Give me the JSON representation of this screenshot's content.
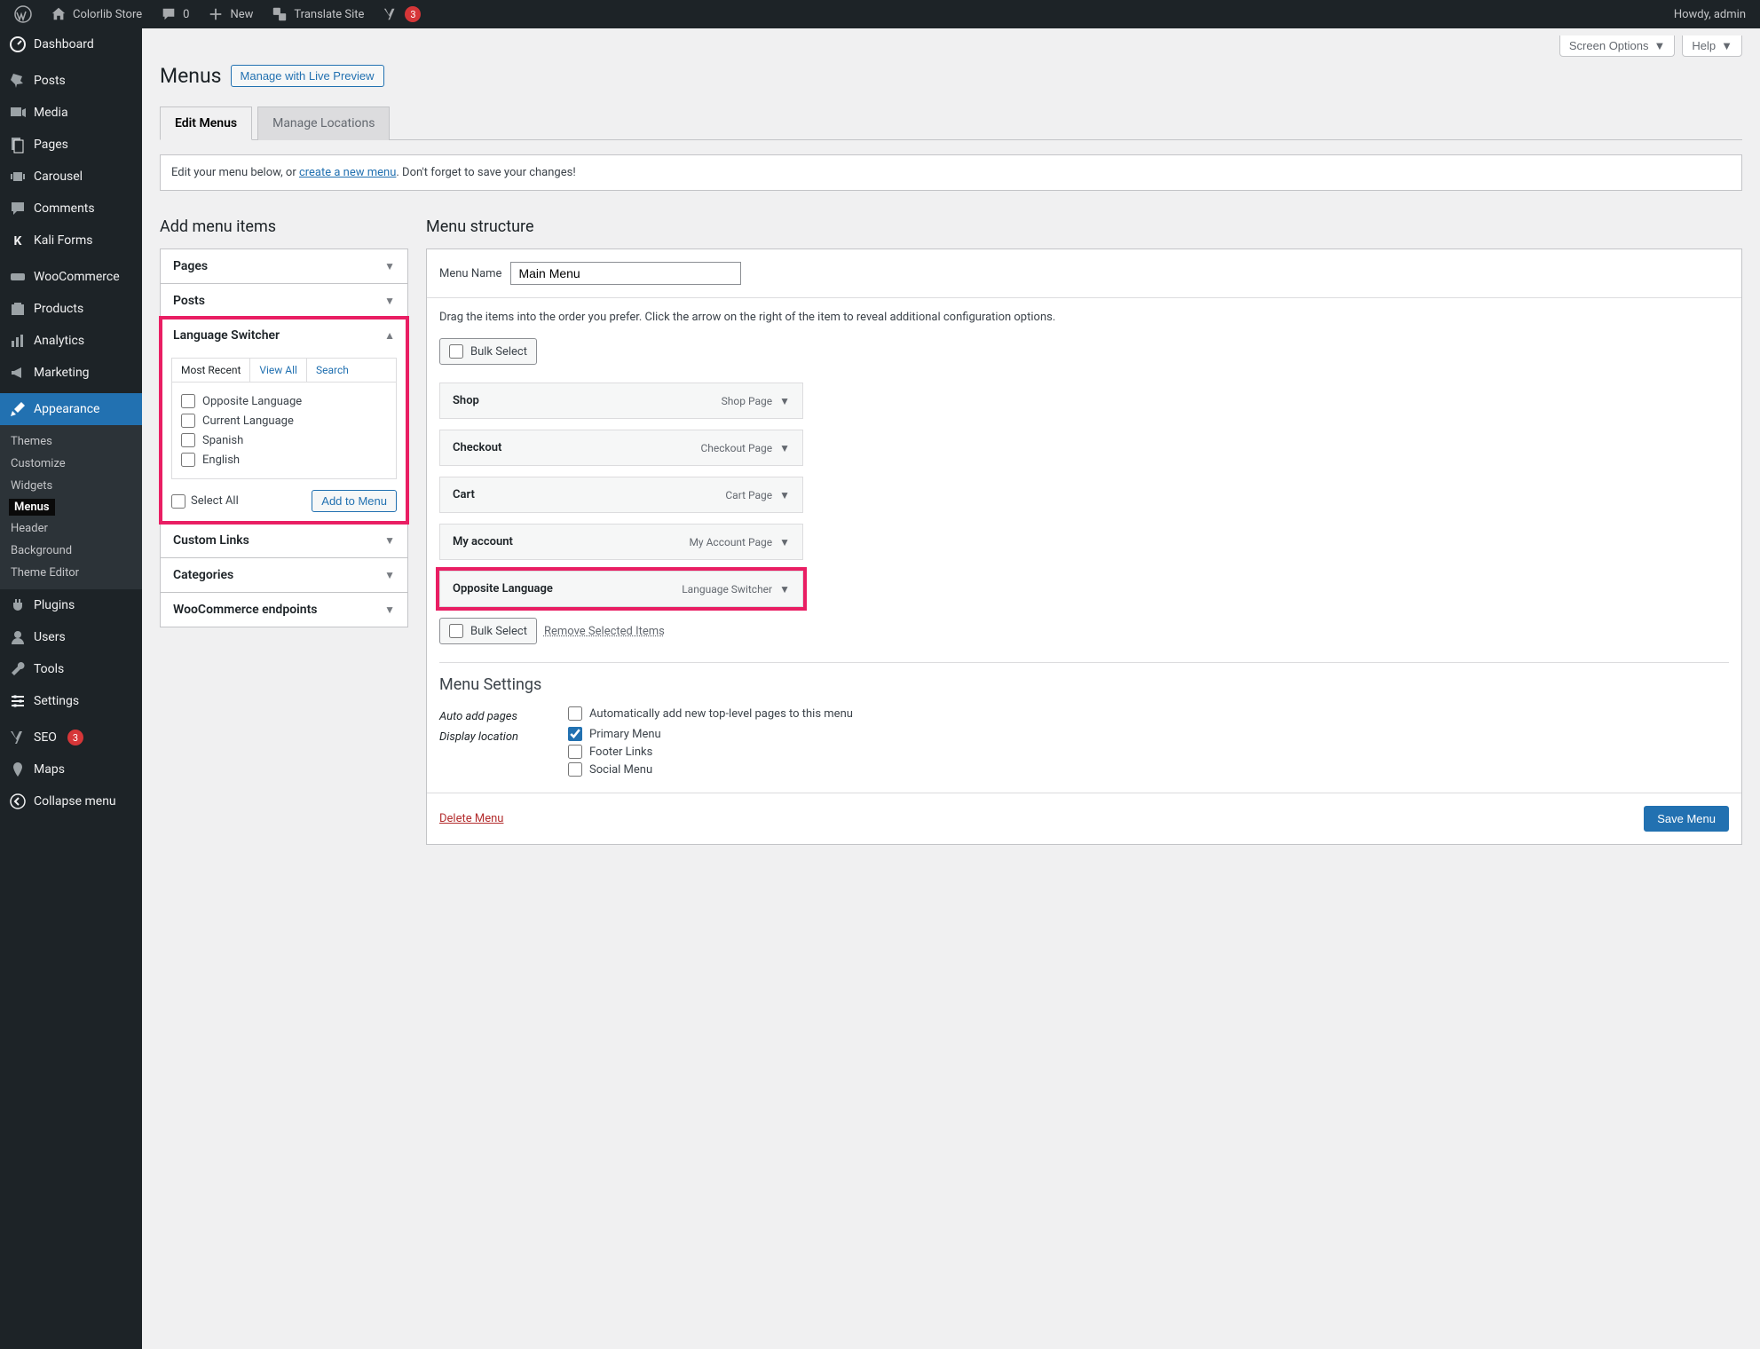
{
  "adminbar": {
    "site_name": "Colorlib Store",
    "comments_count": "0",
    "new_label": "New",
    "translate_label": "Translate Site",
    "yoast_count": "3",
    "howdy": "Howdy, admin"
  },
  "sidebar": {
    "items": [
      {
        "label": "Dashboard"
      },
      {
        "label": "Posts"
      },
      {
        "label": "Media"
      },
      {
        "label": "Pages"
      },
      {
        "label": "Carousel"
      },
      {
        "label": "Comments"
      },
      {
        "label": "Kali Forms"
      },
      {
        "label": "WooCommerce"
      },
      {
        "label": "Products"
      },
      {
        "label": "Analytics"
      },
      {
        "label": "Marketing"
      },
      {
        "label": "Appearance"
      },
      {
        "label": "Plugins"
      },
      {
        "label": "Users"
      },
      {
        "label": "Tools"
      },
      {
        "label": "Settings"
      },
      {
        "label": "SEO"
      },
      {
        "label": "Maps"
      },
      {
        "label": "Collapse menu"
      }
    ],
    "seo_badge": "3",
    "appearance_sub": [
      {
        "label": "Themes"
      },
      {
        "label": "Customize"
      },
      {
        "label": "Widgets"
      },
      {
        "label": "Menus"
      },
      {
        "label": "Header"
      },
      {
        "label": "Background"
      },
      {
        "label": "Theme Editor"
      }
    ]
  },
  "header": {
    "screen_options": "Screen Options",
    "help": "Help"
  },
  "page": {
    "title": "Menus",
    "live_preview": "Manage with Live Preview",
    "tabs": {
      "edit": "Edit Menus",
      "locations": "Manage Locations"
    },
    "notice_pre": "Edit your menu below, or ",
    "notice_link": "create a new menu",
    "notice_post": ". Don't forget to save your changes!"
  },
  "add_items": {
    "title": "Add menu items",
    "panels": {
      "pages": "Pages",
      "posts": "Posts",
      "lang": "Language Switcher",
      "custom": "Custom Links",
      "categories": "Categories",
      "woo": "WooCommerce endpoints"
    },
    "lang_panel": {
      "tabs": {
        "recent": "Most Recent",
        "all": "View All",
        "search": "Search"
      },
      "options": [
        "Opposite Language",
        "Current Language",
        "Spanish",
        "English"
      ],
      "select_all": "Select All",
      "add_btn": "Add to Menu"
    }
  },
  "structure": {
    "title": "Menu structure",
    "name_label": "Menu Name",
    "name_value": "Main Menu",
    "instruction": "Drag the items into the order you prefer. Click the arrow on the right of the item to reveal additional configuration options.",
    "bulk_select": "Bulk Select",
    "remove_selected": "Remove Selected Items",
    "items": [
      {
        "title": "Shop",
        "type": "Shop Page"
      },
      {
        "title": "Checkout",
        "type": "Checkout Page"
      },
      {
        "title": "Cart",
        "type": "Cart Page"
      },
      {
        "title": "My account",
        "type": "My Account Page"
      },
      {
        "title": "Opposite Language",
        "type": "Language Switcher"
      }
    ],
    "settings": {
      "title": "Menu Settings",
      "auto_label": "Auto add pages",
      "auto_opt": "Automatically add new top-level pages to this menu",
      "display_label": "Display location",
      "locations": [
        "Primary Menu",
        "Footer Links",
        "Social Menu"
      ]
    },
    "delete": "Delete Menu",
    "save": "Save Menu"
  }
}
